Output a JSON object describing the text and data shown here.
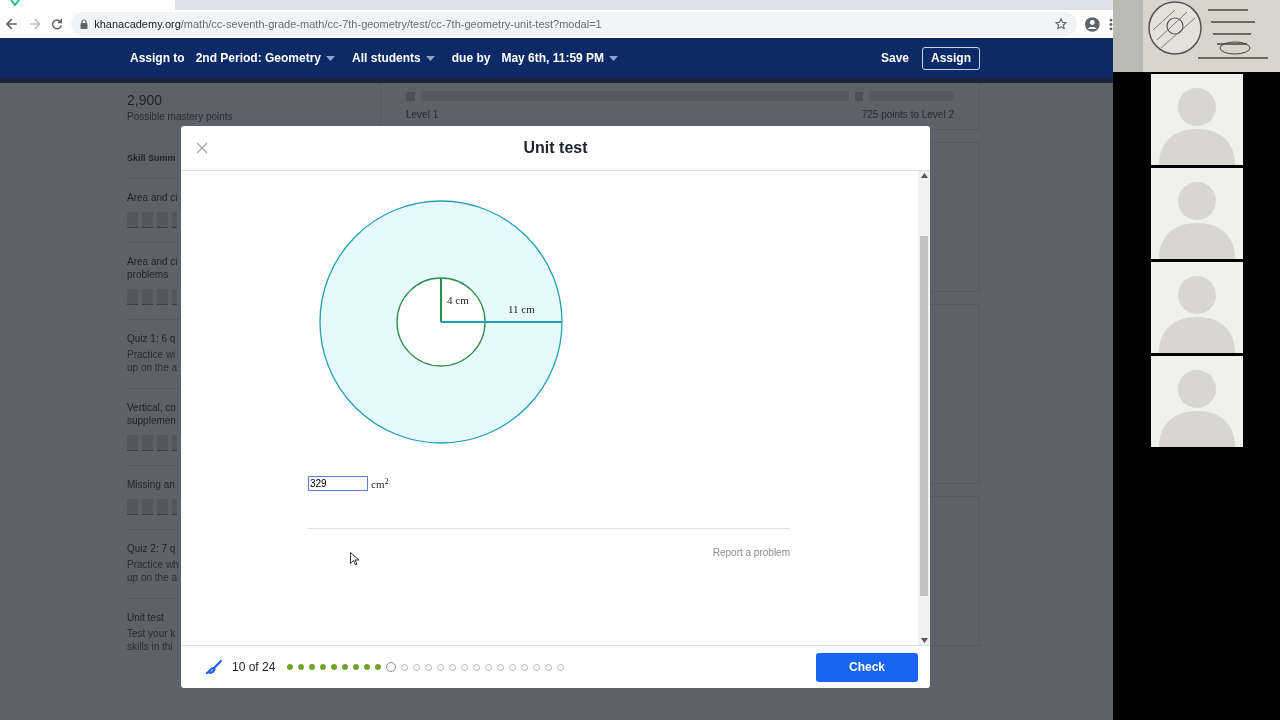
{
  "browser": {
    "url_domain": "khanacademy.org",
    "url_path": "/math/cc-seventh-grade-math/cc-7th-geometry/test/cc-7th-geometry-unit-test?modal=1"
  },
  "assign_bar": {
    "items": [
      {
        "kind": "label",
        "text": "Assign to"
      },
      {
        "kind": "dropdown",
        "text": "2nd Period: Geometry"
      },
      {
        "kind": "dropdown",
        "text": "All students"
      },
      {
        "kind": "label",
        "text": "due by"
      },
      {
        "kind": "dropdown",
        "text": "May 6th, 11:59 PM"
      }
    ],
    "save": "Save",
    "assign": "Assign"
  },
  "background": {
    "points": "2,900",
    "points_label": "Possible mastery points",
    "level_left": "Level 1",
    "level_right": "725 points to Level 2",
    "section_title": "Skill Summ",
    "items": [
      {
        "kind": "skill",
        "lines": [
          "Area and ci"
        ]
      },
      {
        "kind": "skill",
        "lines": [
          "Area and ci",
          "problems"
        ]
      },
      {
        "kind": "quiz",
        "lines": [
          "Quiz 1: 6 q"
        ],
        "desc": [
          "Practice wi",
          "up on the a"
        ]
      },
      {
        "kind": "skill",
        "lines": [
          "Vertical, co",
          "supplemen"
        ]
      },
      {
        "kind": "skill",
        "lines": [
          "Missing an"
        ]
      },
      {
        "kind": "quiz",
        "lines": [
          "Quiz 2: 7 q"
        ],
        "desc": [
          "Practice wh",
          "up on the a"
        ]
      },
      {
        "kind": "quiz",
        "lines": [
          "Unit test"
        ],
        "desc": [
          "Test your k",
          "skills in thi"
        ]
      }
    ]
  },
  "modal": {
    "title": "Unit test",
    "diagram": {
      "labels": [
        "4 cm",
        "11 cm"
      ]
    },
    "answer": {
      "value": "329",
      "unit": "cm$^{2}$"
    },
    "report": "Report a problem",
    "progress_text": "10 of 24",
    "questions": [
      {
        "kind": "done"
      },
      {
        "kind": "done"
      },
      {
        "kind": "done"
      },
      {
        "kind": "done"
      },
      {
        "kind": "done"
      },
      {
        "kind": "done"
      },
      {
        "kind": "done"
      },
      {
        "kind": "done"
      },
      {
        "kind": "done"
      },
      {
        "kind": "current"
      },
      {
        "kind": "todo"
      },
      {
        "kind": "todo"
      },
      {
        "kind": "todo"
      },
      {
        "kind": "todo"
      },
      {
        "kind": "todo"
      },
      {
        "kind": "todo"
      },
      {
        "kind": "todo"
      },
      {
        "kind": "todo"
      },
      {
        "kind": "todo"
      },
      {
        "kind": "todo"
      },
      {
        "kind": "todo"
      },
      {
        "kind": "todo"
      },
      {
        "kind": "todo"
      },
      {
        "kind": "todo"
      }
    ],
    "check": "Check"
  },
  "participants": [
    {
      "kind": "picture"
    },
    {
      "kind": "avatar"
    },
    {
      "kind": "avatar"
    },
    {
      "kind": "avatar"
    },
    {
      "kind": "avatar"
    }
  ]
}
